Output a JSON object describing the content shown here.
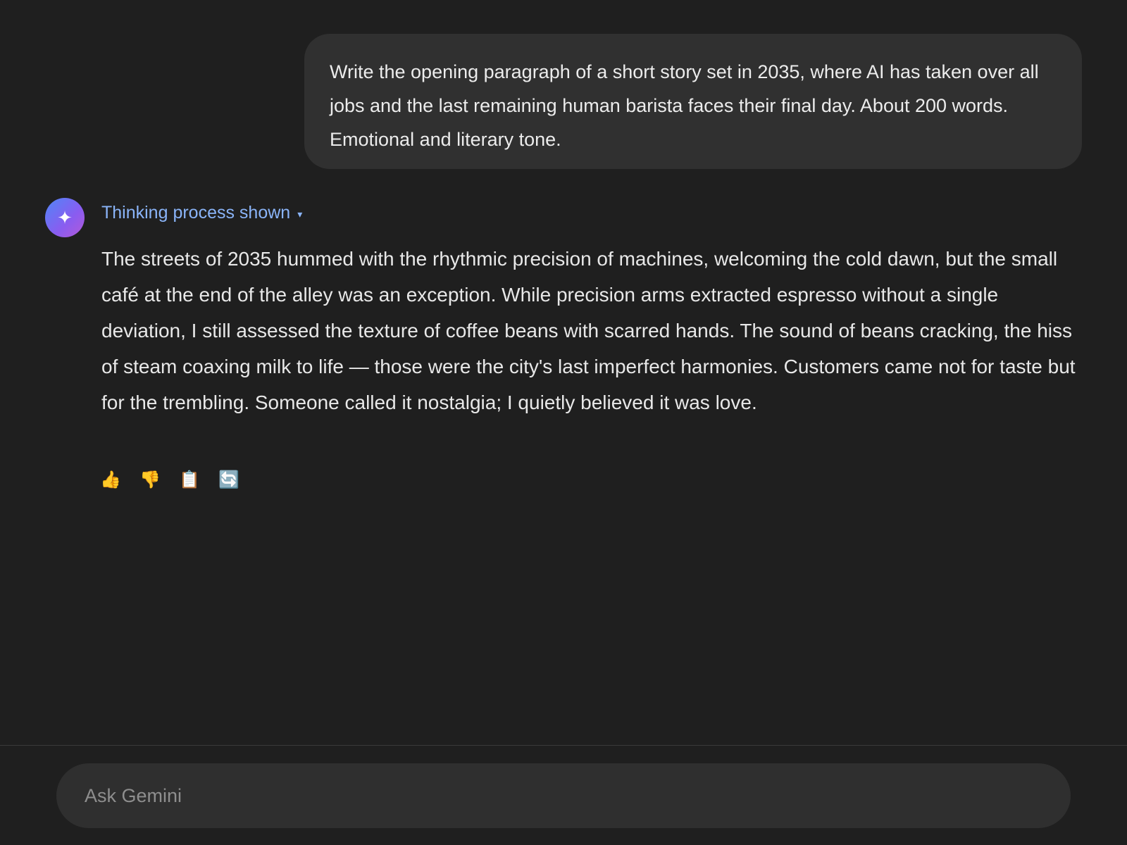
{
  "user_message": {
    "text": "Write the opening paragraph of a short story set in 2035, where AI has taken over all jobs and the last remaining human barista faces their final day. About 200 words. Emotional and literary tone."
  },
  "assistant": {
    "avatar_icon": "sparkle-icon",
    "avatar_glyph": "✦",
    "thinking_label": "Thinking process shown",
    "thinking_caret": "▾",
    "response_text": "The streets of 2035 hummed with the rhythmic precision of machines, welcoming the cold dawn, but the small café at the end of the alley was an exception. While precision arms extracted espresso without a single deviation, I still assessed the texture of coffee beans with scarred hands. The sound of beans cracking, the hiss of steam coaxing milk to life — those were the city's last imperfect harmonies. Customers came not for taste but for the trembling. Someone called it nostalgia; I quietly believed it was love.",
    "actions": [
      {
        "name": "thumbs-up-icon",
        "glyph": "👍"
      },
      {
        "name": "thumbs-down-icon",
        "glyph": "👎"
      },
      {
        "name": "copy-icon",
        "glyph": "📋"
      },
      {
        "name": "regenerate-icon",
        "glyph": "🔄"
      }
    ]
  },
  "input": {
    "placeholder": "Ask Gemini",
    "value": ""
  },
  "colors": {
    "background": "#1f1f1f",
    "user_bubble": "#303030",
    "link_accent": "#8ab4f8",
    "input_bar": "#2f2f2f"
  }
}
